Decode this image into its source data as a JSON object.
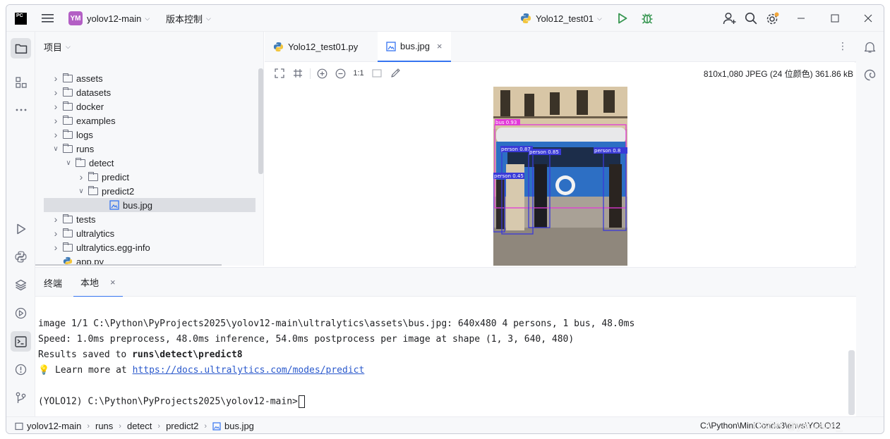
{
  "titlebar": {
    "logo": "PC",
    "project_badge": "YM",
    "project_name": "yolov12-main",
    "vcs_label": "版本控制",
    "run_config": "Yolo12_test01",
    "icons": [
      "menu-icon",
      "python-icon",
      "run-icon",
      "debug-icon",
      "add-user-icon",
      "search-icon",
      "gear-icon",
      "minimize-icon",
      "maximize-icon",
      "close-icon"
    ]
  },
  "project_panel": {
    "title": "项目",
    "items": [
      {
        "label": "assets",
        "type": "folder",
        "expanded": false
      },
      {
        "label": "datasets",
        "type": "folder",
        "expanded": false
      },
      {
        "label": "docker",
        "type": "folder",
        "expanded": false
      },
      {
        "label": "examples",
        "type": "folder",
        "expanded": false
      },
      {
        "label": "logs",
        "type": "folder",
        "expanded": false
      },
      {
        "label": "runs",
        "type": "folder",
        "expanded": true
      },
      {
        "label": "detect",
        "type": "folder",
        "expanded": true
      },
      {
        "label": "predict",
        "type": "folder",
        "expanded": false
      },
      {
        "label": "predict2",
        "type": "folder",
        "expanded": true
      },
      {
        "label": "bus.jpg",
        "type": "image",
        "selected": true
      },
      {
        "label": "tests",
        "type": "package",
        "expanded": false
      },
      {
        "label": "ultralytics",
        "type": "package",
        "expanded": false
      },
      {
        "label": "ultralytics.egg-info",
        "type": "folder",
        "expanded": false
      },
      {
        "label": "app.py",
        "type": "python"
      }
    ]
  },
  "editor": {
    "tabs": [
      {
        "label": "Yolo12_test01.py",
        "active": false
      },
      {
        "label": "bus.jpg",
        "active": true
      }
    ],
    "zoom_actual": "1:1",
    "image_info": "810x1,080 JPEG (24 位颜色) 361.86 kB",
    "detections": [
      {
        "label": "bus 0.93"
      },
      {
        "label": "person 0.87"
      },
      {
        "label": "person 0.85"
      },
      {
        "label": "person 0.8"
      },
      {
        "label": "person 0.45"
      }
    ]
  },
  "terminal": {
    "tabs": [
      {
        "label": "终端",
        "active": false
      },
      {
        "label": "本地",
        "active": true
      }
    ],
    "lines": {
      "l1": "image 1/1 C:\\Python\\PyProjects2025\\yolov12-main\\ultralytics\\assets\\bus.jpg: 640x480 4 persons, 1 bus, 48.0ms",
      "l2": "Speed: 1.0ms preprocess, 48.0ms inference, 54.0ms postprocess per image at shape (1, 3, 640, 480)",
      "l3_prefix": "Results saved to ",
      "l3_bold": "runs\\detect\\predict8",
      "l4_prefix": " Learn more at ",
      "l4_link": "https://docs.ultralytics.com/modes/predict",
      "prompt": "(YOLO12) C:\\Python\\PyProjects2025\\yolov12-main>"
    }
  },
  "statusbar": {
    "breadcrumb": [
      "yolov12-main",
      "runs",
      "detect",
      "predict2",
      "bus.jpg"
    ],
    "interpreter": "C:\\Python\\MiniConda3\\envs\\YOLO12",
    "watermark": "CSDN @youcans_"
  }
}
